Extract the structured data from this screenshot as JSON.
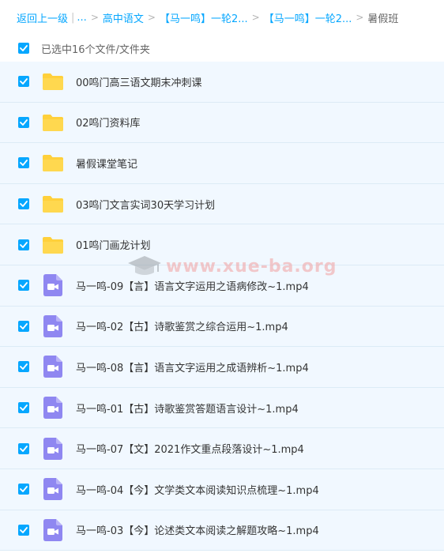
{
  "breadcrumb": {
    "back": "返回上一级",
    "ellipsis": "...",
    "crumb1": "高中语文",
    "crumb2": "【马一鸣】一轮2...",
    "crumb3": "【马一鸣】一轮2...",
    "current": "暑假班",
    "separator": ">",
    "pipe": "|"
  },
  "selection": {
    "label": "已选中16个文件/文件夹"
  },
  "colors": {
    "accent": "#06a7ff",
    "row_bg": "#f1f8ff",
    "folder": "#ffd03b",
    "video": "#8f87f1"
  },
  "files": [
    {
      "name": "00鸣门高三语文期末冲刺课",
      "type": "folder",
      "icon": "folder-icon"
    },
    {
      "name": "02鸣门资料库",
      "type": "folder",
      "icon": "folder-icon"
    },
    {
      "name": "暑假课堂笔记",
      "type": "folder",
      "icon": "folder-icon"
    },
    {
      "name": "03鸣门文言实词30天学习计划",
      "type": "folder",
      "icon": "folder-icon"
    },
    {
      "name": "01鸣门画龙计划",
      "type": "folder",
      "icon": "folder-icon"
    },
    {
      "name": "马一鸣-09【言】语言文字运用之语病修改~1.mp4",
      "type": "video",
      "icon": "video-icon"
    },
    {
      "name": "马一鸣-02【古】诗歌鉴赏之综合运用~1.mp4",
      "type": "video",
      "icon": "video-icon"
    },
    {
      "name": "马一鸣-08【言】语言文字运用之成语辨析~1.mp4",
      "type": "video",
      "icon": "video-icon"
    },
    {
      "name": "马一鸣-01【古】诗歌鉴赏答题语言设计~1.mp4",
      "type": "video",
      "icon": "video-icon"
    },
    {
      "name": "马一鸣-07【文】2021作文重点段落设计~1.mp4",
      "type": "video",
      "icon": "video-icon"
    },
    {
      "name": "马一鸣-04【今】文学类文本阅读知识点梳理~1.mp4",
      "type": "video",
      "icon": "video-icon"
    },
    {
      "name": "马一鸣-03【今】论述类文本阅读之解题攻略~1.mp4",
      "type": "video",
      "icon": "video-icon"
    }
  ],
  "watermark": {
    "text": "www.xue-ba.org",
    "icon": "graduation-cap-icon"
  }
}
